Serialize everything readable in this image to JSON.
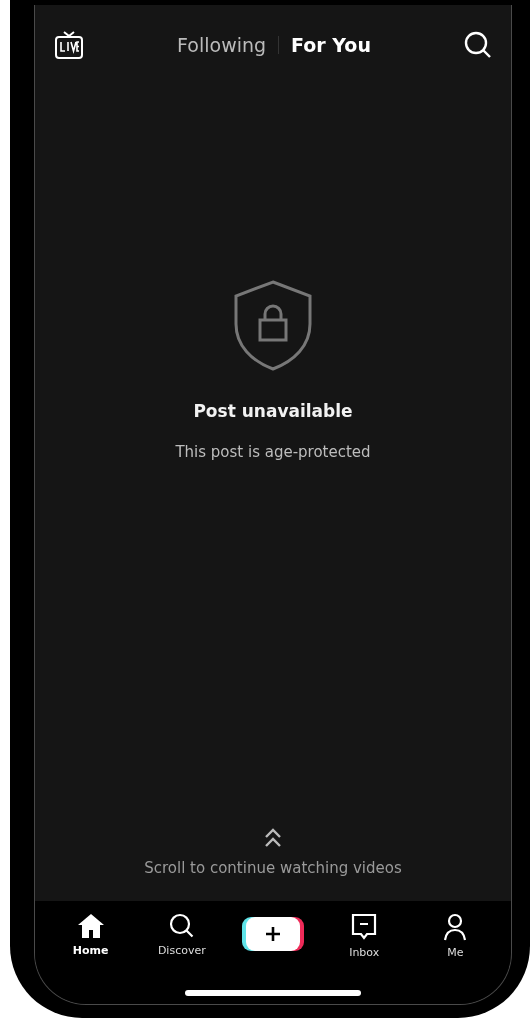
{
  "top_bar": {
    "tabs": [
      {
        "label": "Following",
        "selected": false
      },
      {
        "label": "For You",
        "selected": true
      }
    ]
  },
  "message": {
    "title": "Post unavailable",
    "subtitle": "This post is age-protected"
  },
  "scroll_hint": "Scroll to continue watching videos",
  "bottom_nav": [
    {
      "kind": "home",
      "label": "Home",
      "selected": true
    },
    {
      "kind": "discover",
      "label": "Discover",
      "selected": false
    },
    {
      "kind": "create"
    },
    {
      "kind": "inbox",
      "label": "Inbox",
      "selected": false
    },
    {
      "kind": "me",
      "label": "Me",
      "selected": false
    }
  ]
}
